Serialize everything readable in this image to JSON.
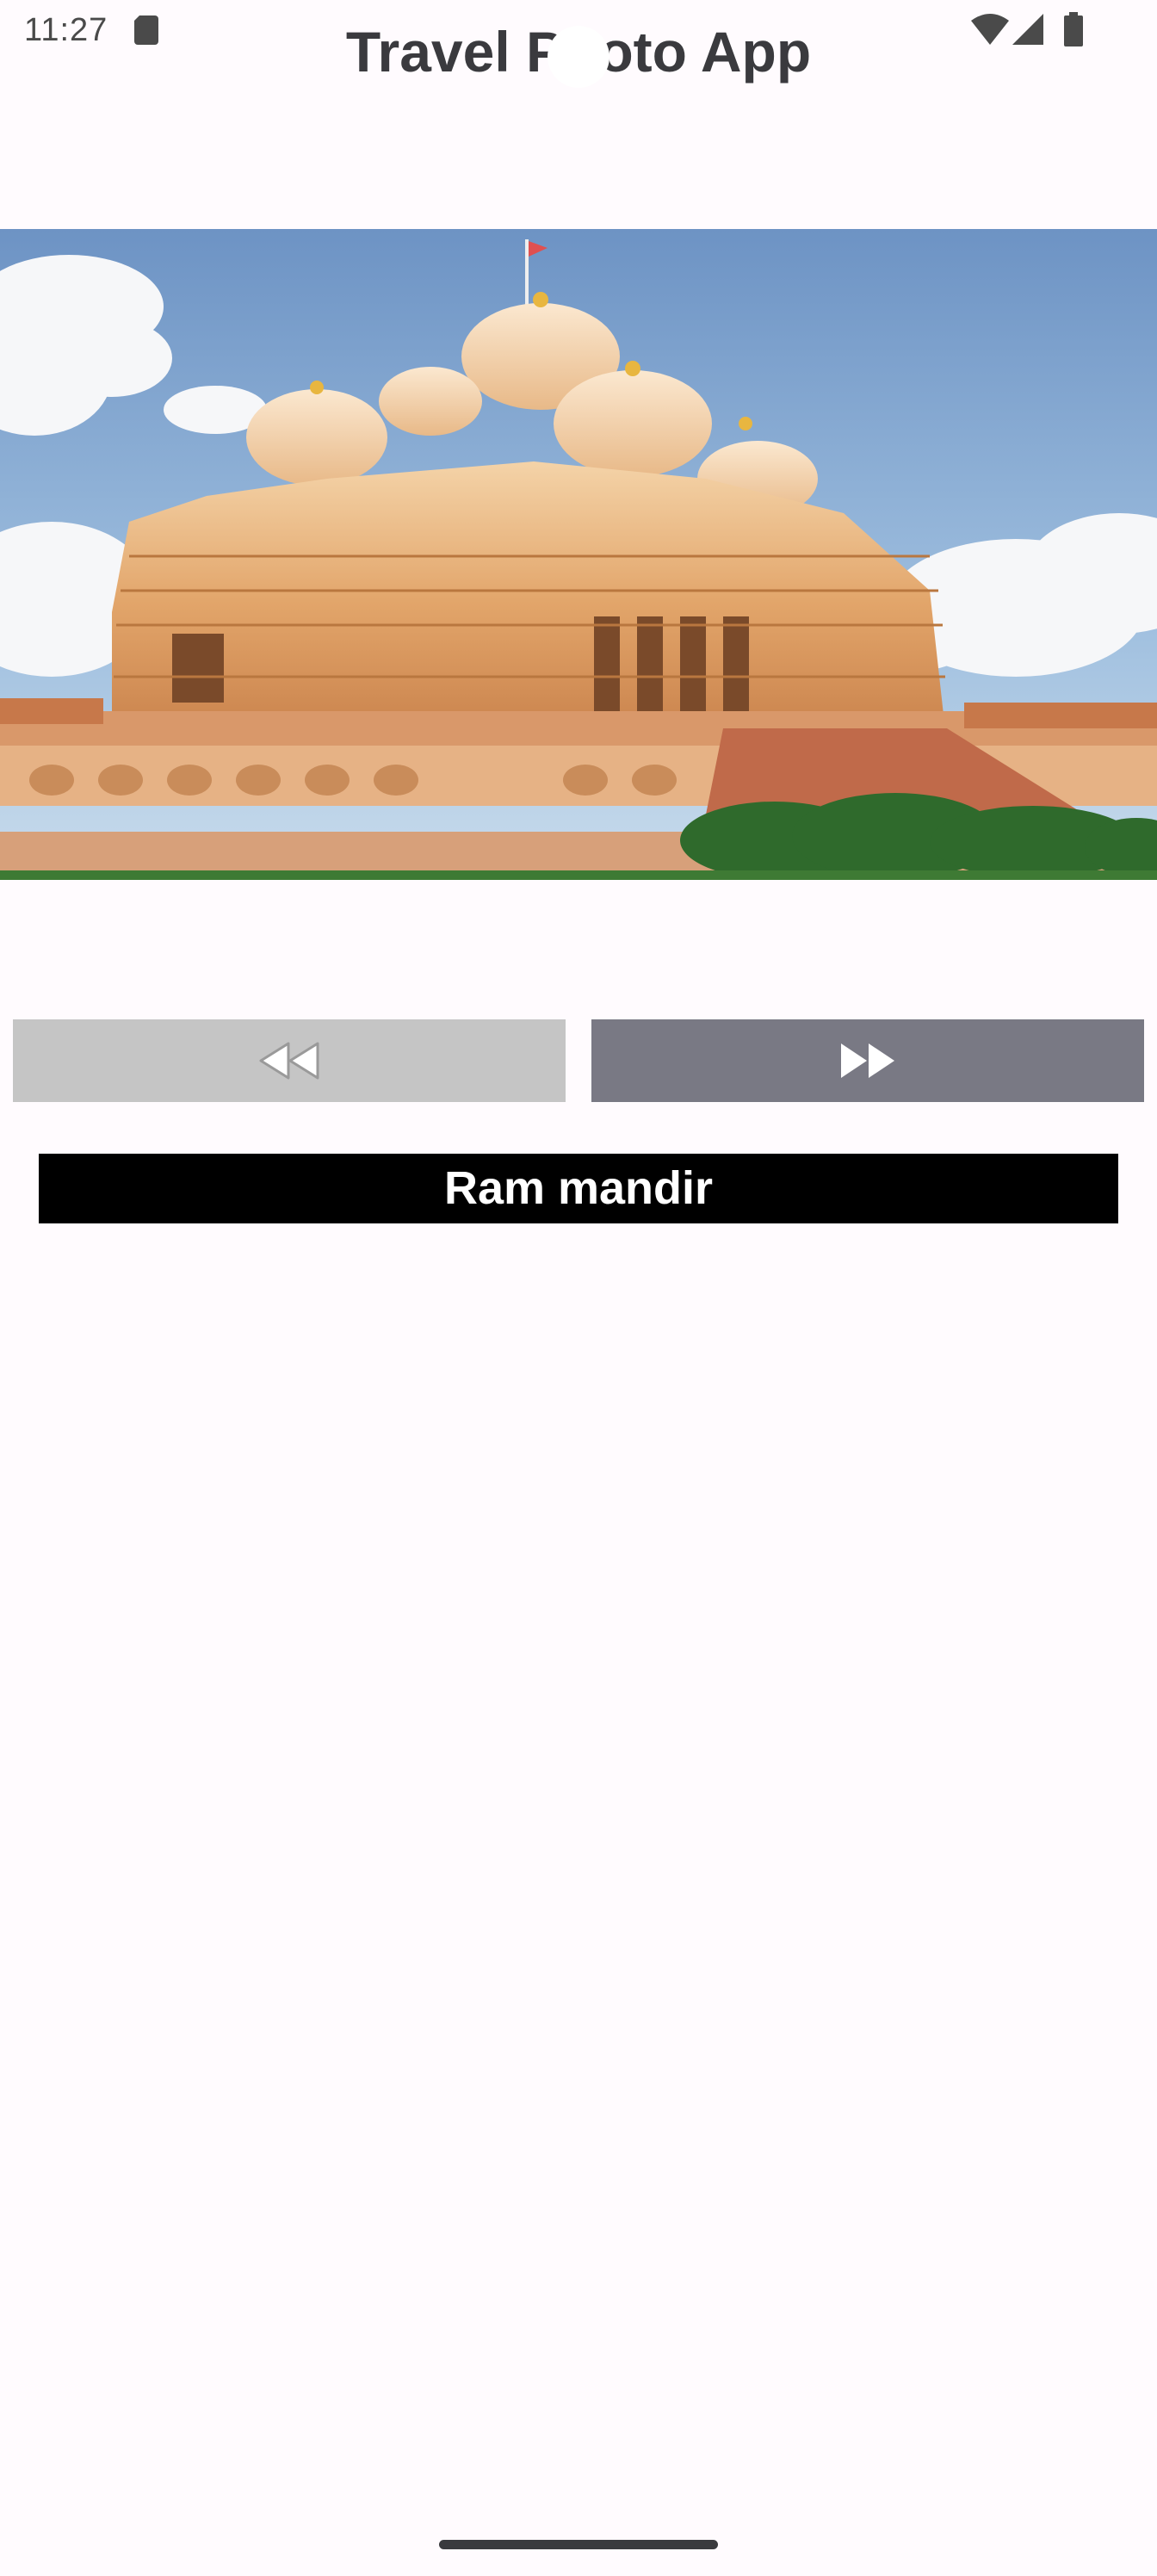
{
  "status_bar": {
    "time": "11:27",
    "icons": [
      "sd-card-icon",
      "wifi-icon",
      "signal-icon",
      "battery-icon"
    ]
  },
  "app": {
    "title": "Travel Photo App"
  },
  "photo": {
    "subject": "temple",
    "caption": "Ram mandir"
  },
  "controls": {
    "previous_icon": "rewind-icon",
    "next_icon": "fast-forward-icon"
  },
  "colors": {
    "background": "#fffbfe",
    "prev_button": "#c5c5c5",
    "next_button": "#797984",
    "caption_bg": "#000000",
    "caption_text": "#ffffff"
  }
}
